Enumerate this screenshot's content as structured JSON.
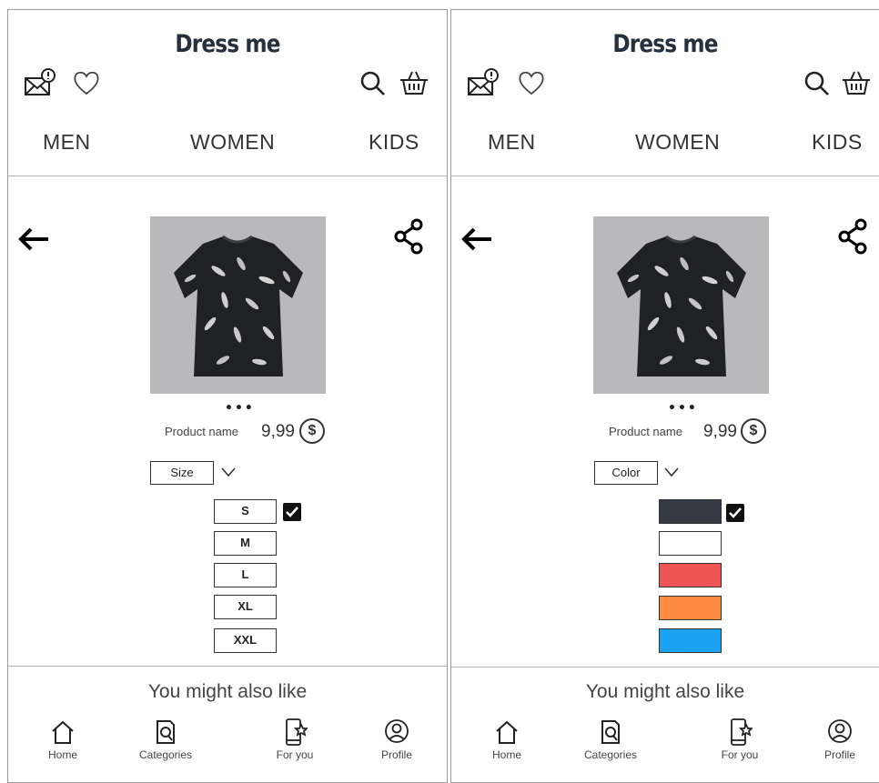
{
  "app": {
    "title": "Dress me"
  },
  "nav": {
    "men": "MEN",
    "women": "WOMEN",
    "kids": "KIDS"
  },
  "header_icons": [
    "mail-alert-icon",
    "heart-icon",
    "search-icon",
    "basket-icon"
  ],
  "product": {
    "name": "Product name",
    "price": "9,99",
    "currency_symbol": "$",
    "carousel_dots": "•••"
  },
  "left_panel": {
    "selector_label": "Size",
    "options": [
      "S",
      "M",
      "L",
      "XL",
      "XXL"
    ],
    "selected_index": 0
  },
  "right_panel": {
    "selector_label": "Color",
    "swatches": [
      "#353b45",
      "#ffffff",
      "#ef5555",
      "#ff8c42",
      "#1aa3f2"
    ],
    "selected_index": 0
  },
  "recommendations": {
    "heading": "You might also like"
  },
  "tabbar": {
    "home": "Home",
    "categories": "Categories",
    "for_you": "For you",
    "profile": "Profile"
  },
  "colors": {
    "title": "#25303d",
    "divider": "#b5b5b5",
    "photo_bg": "#b9b9bb",
    "shirt": "#1f2124"
  }
}
